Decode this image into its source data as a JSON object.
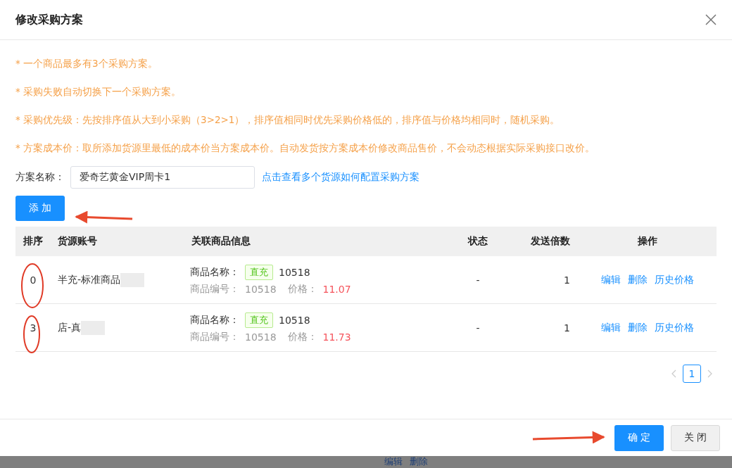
{
  "dialog": {
    "title": "修改采购方案"
  },
  "notices": [
    "* 一个商品最多有3个采购方案。",
    "* 采购失败自动切换下一个采购方案。",
    "* 采购优先级：先按排序值从大到小采购（3>2>1），排序值相同时优先采购价格低的，排序值与价格均相同时，随机采购。",
    "* 方案成本价：取所添加货源里最低的成本价当方案成本价。自动发货按方案成本价修改商品售价，不会动态根据实际采购接口改价。"
  ],
  "plan_name": {
    "label": "方案名称：",
    "value": "爱奇艺黄金VIP周卡1"
  },
  "help_link": "点击查看多个货源如何配置采购方案",
  "add_button": "添 加",
  "table": {
    "columns": [
      "排序",
      "货源账号",
      "关联商品信息",
      "状态",
      "发送倍数",
      "操作"
    ],
    "rows": [
      {
        "sort": "0",
        "account": "半充-标准商品",
        "name_label": "商品名称：",
        "tag": "直充",
        "name": "10518",
        "code_label": "商品编号：",
        "code": "10518",
        "price_label": "价格：",
        "price": "11.07",
        "status": "-",
        "multiple": "1",
        "actions": [
          "编辑",
          "删除",
          "历史价格"
        ]
      },
      {
        "sort": "3",
        "account": "店-真",
        "name_label": "商品名称：",
        "tag": "直充",
        "name": "10518",
        "code_label": "商品编号：",
        "code": "10518",
        "price_label": "价格：",
        "price": "11.73",
        "status": "-",
        "multiple": "1",
        "actions": [
          "编辑",
          "删除",
          "历史价格"
        ]
      }
    ]
  },
  "pagination": {
    "pages": [
      {
        "label": "1",
        "selected": true
      }
    ]
  },
  "footer": {
    "confirm": "确 定",
    "close": "关 闭"
  },
  "background": {
    "links": [
      "编辑",
      "删除"
    ]
  }
}
